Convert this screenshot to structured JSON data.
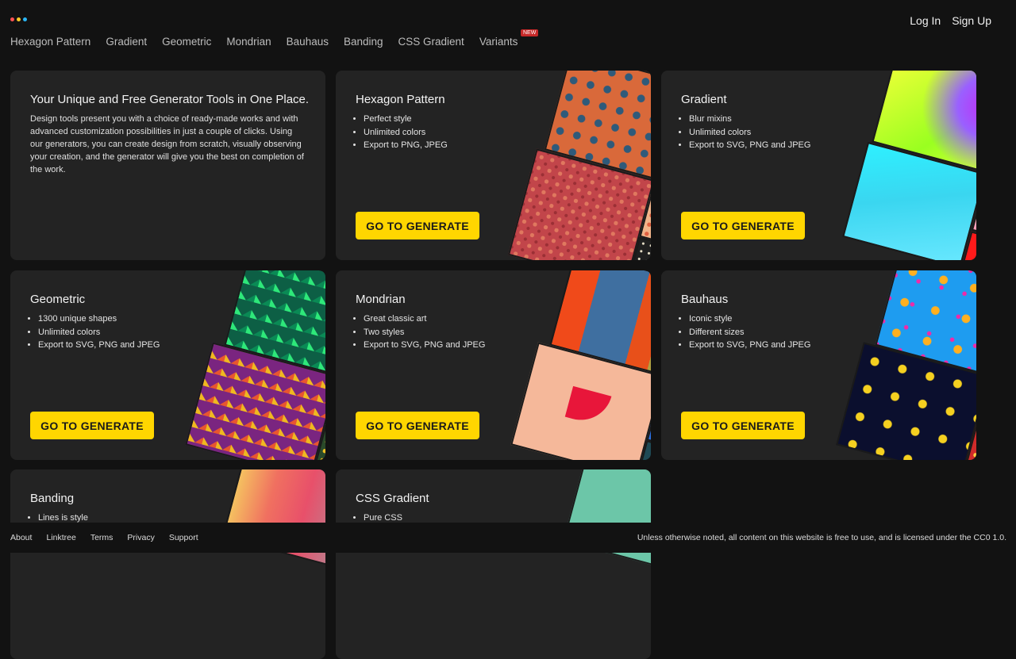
{
  "logo": {
    "dot_colors": [
      "#ff5252",
      "#ffca28",
      "#29b6f6"
    ]
  },
  "auth": {
    "login": "Log In",
    "signup": "Sign Up"
  },
  "nav": {
    "items": [
      "Hexagon Pattern",
      "Gradient",
      "Geometric",
      "Mondrian",
      "Bauhaus",
      "Banding",
      "CSS Gradient",
      "Variants"
    ],
    "new_badge": "NEW"
  },
  "intro": {
    "title": "Your Unique and Free Generator Tools in One Place.",
    "description": "Design tools present you with a choice of ready-made works and with advanced customization possibilities in just a couple of clicks. Using our generators, you can create design from scratch, visually observing your creation, and the generator will give you the best on completion of the work."
  },
  "cards": [
    {
      "title": "Hexagon Pattern",
      "features": [
        "Perfect style",
        "Unlimited colors",
        "Export to PNG, JPEG"
      ],
      "button": "GO TO GENERATE"
    },
    {
      "title": "Gradient",
      "features": [
        "Blur mixins",
        "Unlimited colors",
        "Export to SVG, PNG and JPEG"
      ],
      "button": "GO TO GENERATE"
    },
    {
      "title": "Geometric",
      "features": [
        "1300 unique shapes",
        "Unlimited colors",
        "Export to SVG, PNG and JPEG"
      ],
      "button": "GO TO GENERATE"
    },
    {
      "title": "Mondrian",
      "features": [
        "Great classic art",
        "Two styles",
        "Export to SVG, PNG and JPEG"
      ],
      "button": "GO TO GENERATE"
    },
    {
      "title": "Bauhaus",
      "features": [
        "Iconic style",
        "Different sizes",
        "Export to SVG, PNG and JPEG"
      ],
      "button": "GO TO GENERATE"
    },
    {
      "title": "Banding",
      "features": [
        "Lines is style"
      ]
    },
    {
      "title": "CSS Gradient",
      "features": [
        "Pure CSS"
      ]
    }
  ],
  "footer": {
    "links": [
      "About",
      "Linktree",
      "Terms",
      "Privacy",
      "Support"
    ],
    "license": "Unless otherwise noted, all content on this website is free to use, and is licensed under the CC0 1.0."
  }
}
